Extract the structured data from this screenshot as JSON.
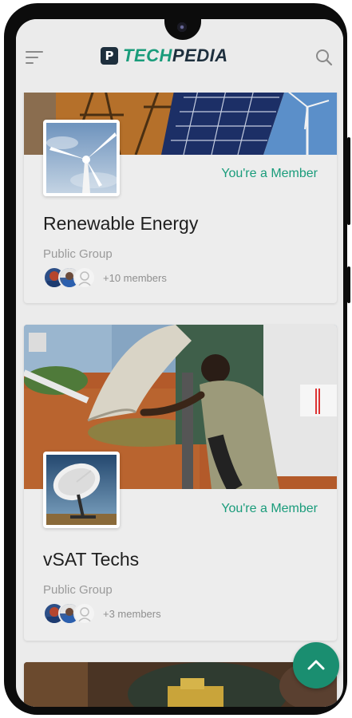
{
  "app": {
    "logo_mark": "P",
    "logo_part1": "TECH",
    "logo_part2": "PEDIA"
  },
  "icons": {
    "menu": "menu-icon",
    "search": "search-icon",
    "scroll_top": "chevron-up-icon"
  },
  "colors": {
    "accent": "#1a9c7b",
    "logo_dark": "#1e2f3d",
    "fab": "#1a8e70"
  },
  "groups": [
    {
      "name": "Renewable Energy",
      "membership": "You're a Member",
      "type": "Public Group",
      "members": "+10 members"
    },
    {
      "name": "vSAT Techs",
      "membership": "You're a Member",
      "type": "Public Group",
      "members": "+3 members"
    }
  ]
}
